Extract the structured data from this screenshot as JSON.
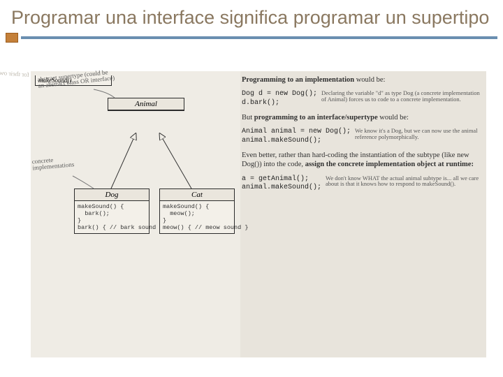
{
  "title": "Programar una interface significa programar un supertipo",
  "left": {
    "hand_supertype": "abstract supertype (could be an abstract class OR interface)",
    "hand_concrete": "concrete implementations",
    "animal": {
      "name": "Animal",
      "method": "makeSound()"
    },
    "dog": {
      "name": "Dog",
      "body": "makeSound() {\n  bark();\n}\nbark() { // bark sound }"
    },
    "cat": {
      "name": "Cat",
      "body": "makeSound() {\n  meow();\n}\nmeow() { // meow sound }"
    },
    "ghost": "for their own behaviors."
  },
  "right": {
    "p1a": "Programming to an implementation",
    "p1b": " would be:",
    "code1": "Dog d = new Dog();\nd.bark();",
    "ann1": "Declaring the variable \"d\" as type Dog (a concrete implementation of Animal) forces us to code to a concrete implementation.",
    "p2a": "But ",
    "p2b": "programming to an interface/supertype",
    "p2c": " would be:",
    "code2": "Animal animal = new Dog();\nanimal.makeSound();",
    "ann2": "We know it's a Dog, but we can now use the animal reference polymorphically.",
    "p3a": "Even better, rather than hard-coding the instantiation of the subtype (like new Dog()) into the code, ",
    "p3b": "assign the concrete implementation object at runtime:",
    "code3": "a = getAnimal();\nanimal.makeSound();",
    "ann3": "We don't know WHAT the actual animal subtype is... all we care about is that it knows how to respond to makeSound()."
  }
}
